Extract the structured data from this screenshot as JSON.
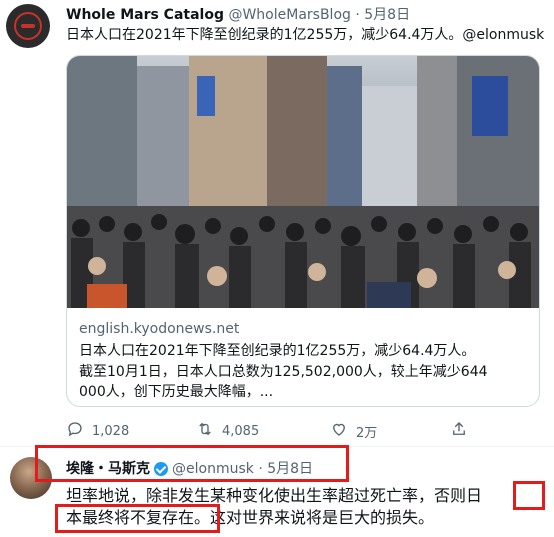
{
  "tweet1": {
    "author_name": "Whole Mars Catalog",
    "handle": "@WholeMarsBlog",
    "dot": "·",
    "date": "5月8日",
    "text": "日本人口在2021年下降至创纪录的1亿255万，减少64.4万人。@elonmusk",
    "card": {
      "domain": "english.kyodonews.net",
      "title": "日本人口在2021年下降至创纪录的1亿255万，减少64.4万人。",
      "desc_line1": "截至10月1日，日本人口总数为125,502,000人，较上年减少644",
      "desc_line2": "000人，创下历史最大降幅，..."
    },
    "actions": {
      "replies": "1,028",
      "retweets": "4,085",
      "likes": "2万"
    },
    "icons": {
      "reply": "reply-icon",
      "retweet": "retweet-icon",
      "like": "like-icon",
      "share": "share-icon"
    }
  },
  "tweet2": {
    "author_name": "埃隆・马斯克",
    "handle": "@elonmusk",
    "dot": "·",
    "date": "5月8日",
    "text_line1_a": "坦率地说，除非发生某种变化使出生率超过死亡率，否则",
    "text_line1_b": "日",
    "text_line2_a": "本最终将不复存在",
    "text_line2_b": "。这对世界来说将是巨大的损失。"
  },
  "colors": {
    "highlight": "#e31b1b",
    "verified": "#1d9bf0",
    "secondary_text": "#536471",
    "border": "#cfd9de"
  }
}
